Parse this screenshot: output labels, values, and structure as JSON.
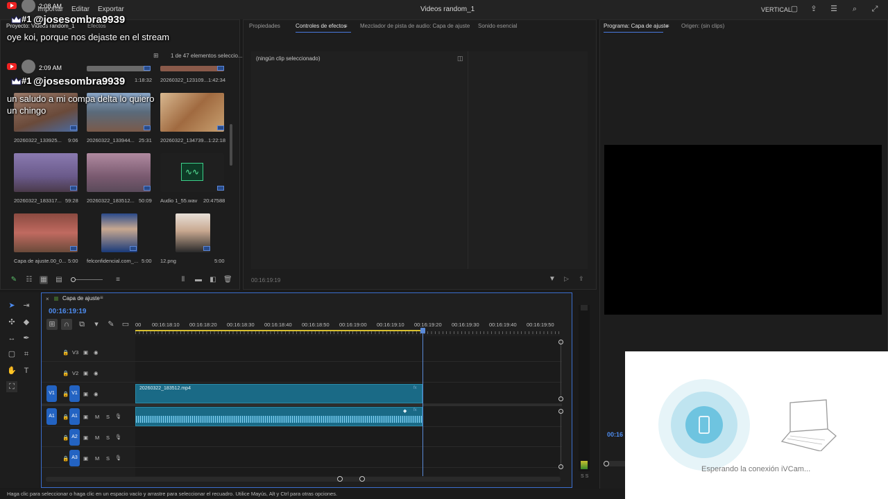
{
  "menubar": {
    "items": [
      "Importar",
      "Editar",
      "Exportar"
    ],
    "title": "Videos random_1",
    "workspace": "VERTICAL"
  },
  "chat": [
    {
      "time": "2:08 AM",
      "rank": "#1",
      "user": "@josesombra9939",
      "message": "oye koi, porque nos dejaste en el stream"
    },
    {
      "time": "2:09 AM",
      "rank": "#1",
      "user": "@josesombra9939",
      "message": "un saludo a mi compa delta lo quiero un chingo"
    }
  ],
  "project": {
    "tabs": [
      "Proyecto: Videos random_1",
      "Efectos"
    ],
    "count": "1 de 47 elementos seleccio...",
    "items": [
      {
        "name": "20260322_133925...",
        "duration": "9:06",
        "color": "#8a6a55"
      },
      {
        "name": "20260322_133944...",
        "duration": "25:31",
        "color": "#6b7f9a"
      },
      {
        "name": "20260322_134739...",
        "duration": "1:22:18",
        "color": "#c49a6c"
      },
      {
        "name": "20260322_183317...",
        "duration": "59:28",
        "color": "#7a6a8c"
      },
      {
        "name": "20260322_183512...",
        "duration": "50:09",
        "color": "#8a5f6e"
      },
      {
        "name": "Audio 1_55.wav",
        "duration": "20:47588",
        "color": "#1f1f1f"
      },
      {
        "name": "Capa de ajuste.00_0...",
        "duration": "5:00",
        "color": "#b06060"
      },
      {
        "name": "felconfidencial.com_...",
        "duration": "5:00",
        "color": "#3a6aa8"
      },
      {
        "name": "12.png",
        "duration": "5:00",
        "color": "#9a8a7a"
      }
    ],
    "top_row": [
      {
        "name": "",
        "duration": "1:18:32"
      },
      {
        "name": "20260322_123109...",
        "duration": "1:42:34"
      }
    ]
  },
  "effects": {
    "tabs": [
      "Propiedades",
      "Controles de efectos",
      "Mezclador de pista de audio: Capa de ajuste",
      "Sonido esencial"
    ],
    "empty": "(ningún clip seleccionado)",
    "timecode": "00:16:19:19"
  },
  "program": {
    "tabs": [
      "Programa: Capa de ajuste",
      "Origen: (sin clips)"
    ],
    "timecode": "00:16"
  },
  "timeline": {
    "sequence": "Capa de ajuste",
    "timecode": "00:16:19:19",
    "ruler": [
      "00",
      "00:16:18:10",
      "00:16:18:20",
      "00:16:18:30",
      "00:16:18:40",
      "00:16:18:50",
      "00:16:19:00",
      "00:16:19:10",
      "00:16:19:20",
      "00:16:19:30",
      "00:16:19:40",
      "00:16:19:50"
    ],
    "video_tracks": [
      "V3",
      "V2",
      "V1"
    ],
    "audio_tracks": [
      "A1",
      "A2",
      "A3"
    ],
    "track_m": "M",
    "track_s": "S",
    "v1_source": "V1",
    "a1_source": "A1",
    "clip_name": "20260322_183512.mp4"
  },
  "status": "Haga clic para seleccionar o haga clic en un espacio vacío y arrastre para seleccionar el recuadro. Utilice Mayús, Alt y Ctrl para otras opciones.",
  "ivcam": {
    "message": "Esperando la conexión iVCam..."
  },
  "meter_labels": "S S"
}
